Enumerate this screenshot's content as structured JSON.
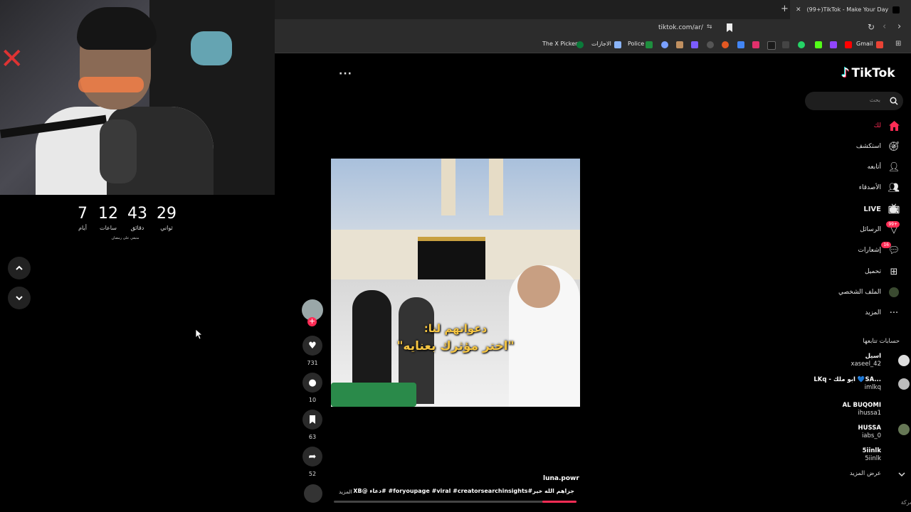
{
  "stream": {
    "countdown": [
      {
        "value": "29",
        "label": "ثواني"
      },
      {
        "value": "43",
        "label": "دقائق"
      },
      {
        "value": "12",
        "label": "ساعات"
      },
      {
        "value": "7",
        "label": "أيام"
      }
    ],
    "countdown_note": "متبقي على رمضان"
  },
  "browser": {
    "tab_title": "(99+)TikTok - Make Your Day",
    "url": "tiktok.com/ar/",
    "bookmarks": [
      "Gmail",
      "Police",
      "الاجازات",
      "The X Picker"
    ]
  },
  "tiktok": {
    "logo": "TikTok",
    "search_placeholder": "بحث",
    "nav": [
      {
        "label": "لك",
        "icon": "home-icon",
        "active": true
      },
      {
        "label": "استكشف",
        "icon": "compass-icon"
      },
      {
        "label": "أتابعه",
        "icon": "user-follow-icon"
      },
      {
        "label": "الأصدقاء",
        "icon": "friends-icon"
      },
      {
        "label": "LIVE",
        "icon": "live-icon"
      },
      {
        "label": "الرسائل",
        "icon": "messages-icon",
        "badge": "99+"
      },
      {
        "label": "إشعارات",
        "icon": "notifications-icon",
        "badge": "16"
      },
      {
        "label": "تحميل",
        "icon": "upload-icon"
      },
      {
        "label": "الملف الشخصي",
        "icon": "profile-icon"
      },
      {
        "label": "المزيد",
        "icon": "more-icon"
      }
    ],
    "following_title": "حسابات تتابعها",
    "following": [
      {
        "name": "اسيل",
        "handle": "xaseel_42"
      },
      {
        "name": "LKq - ابو ملك 💙SA...",
        "handle": "imlkq"
      },
      {
        "name": "AL BUQOMI",
        "handle": "ihussa1"
      },
      {
        "name": "HUSSA",
        "handle": "iabs_0"
      },
      {
        "name": "5iinlk",
        "handle": "5iinlk"
      }
    ],
    "see_more": "عرض المزيد",
    "footer_fragment": "الشركة",
    "video": {
      "caption_line1": "دعواتهم لنا:",
      "caption_line2": "\"اختر مؤثرك بعنايه\"",
      "author": "luna.powr",
      "description": "جزاهم الله خير#foryoupage #viral #creatorsearchinsights# #دعاء @SXB ...",
      "more": "المزيد",
      "progress": 0.14
    },
    "actions": {
      "likes": "731",
      "comments": "10",
      "saves": "63",
      "shares": "52"
    }
  }
}
